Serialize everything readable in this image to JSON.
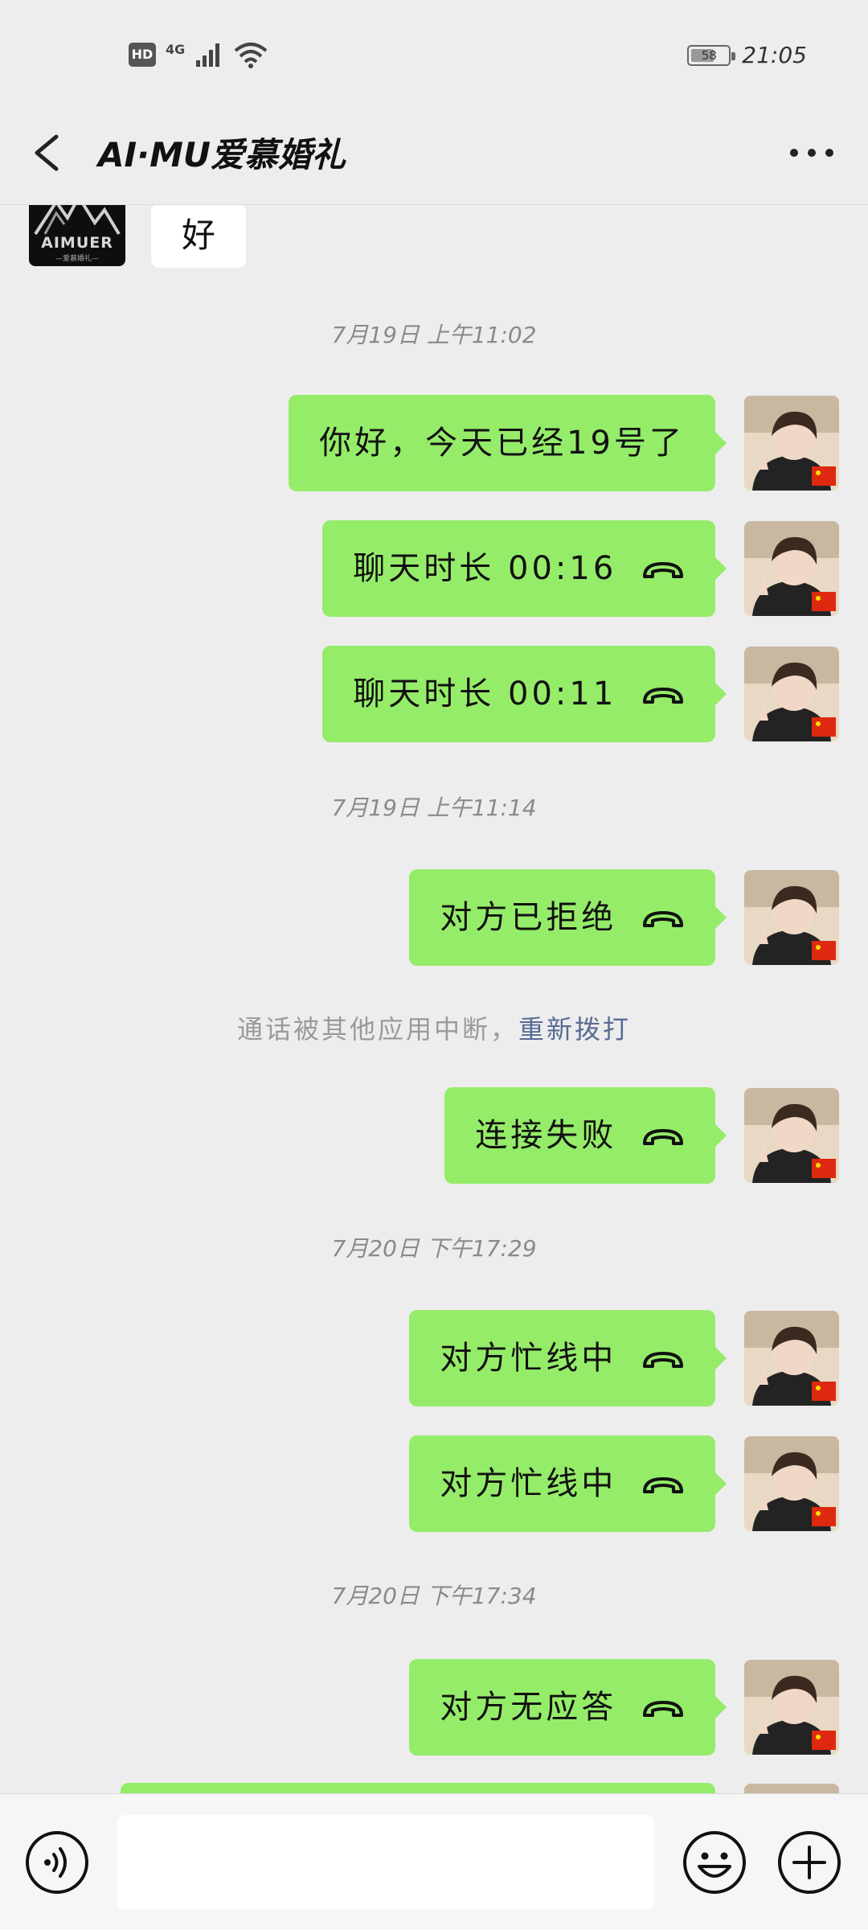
{
  "status_bar": {
    "hd": "HD",
    "network": "4G",
    "battery": "58",
    "time": "21:05"
  },
  "header": {
    "title": "AI·MU爱慕婚礼",
    "back_icon": "chevron-left-icon",
    "more_icon": "more-dots-icon"
  },
  "chat": {
    "first_message": {
      "text": "好",
      "avatar_logo": "AIMUER",
      "avatar_sub": "—爱慕婚礼—"
    },
    "timestamps": [
      "7月19日 上午11:02",
      "7月19日 上午11:14",
      "7月20日 下午17:29",
      "7月20日 下午17:34"
    ],
    "outgoing": [
      {
        "text": "你好，今天已经19号了",
        "call": false
      },
      {
        "text": "聊天时长 00:16",
        "call": true
      },
      {
        "text": "聊天时长 00:11",
        "call": true
      },
      {
        "text": "对方已拒绝",
        "call": true
      },
      {
        "text": "连接失败",
        "call": true
      },
      {
        "text": "对方忙线中",
        "call": true
      },
      {
        "text": "对方忙线中",
        "call": true
      },
      {
        "text": "对方无应答",
        "call": true
      }
    ],
    "system_note": {
      "text": "通话被其他应用中断，",
      "link": "重新拨打"
    }
  },
  "input_bar": {
    "voice_icon": "voice-icon",
    "input_value": "",
    "emoji_icon": "emoji-icon",
    "plus_icon": "plus-icon"
  },
  "colors": {
    "background": "#ededed",
    "bubble_out": "#95ec69",
    "bubble_in": "#ffffff",
    "link": "#576b95"
  }
}
